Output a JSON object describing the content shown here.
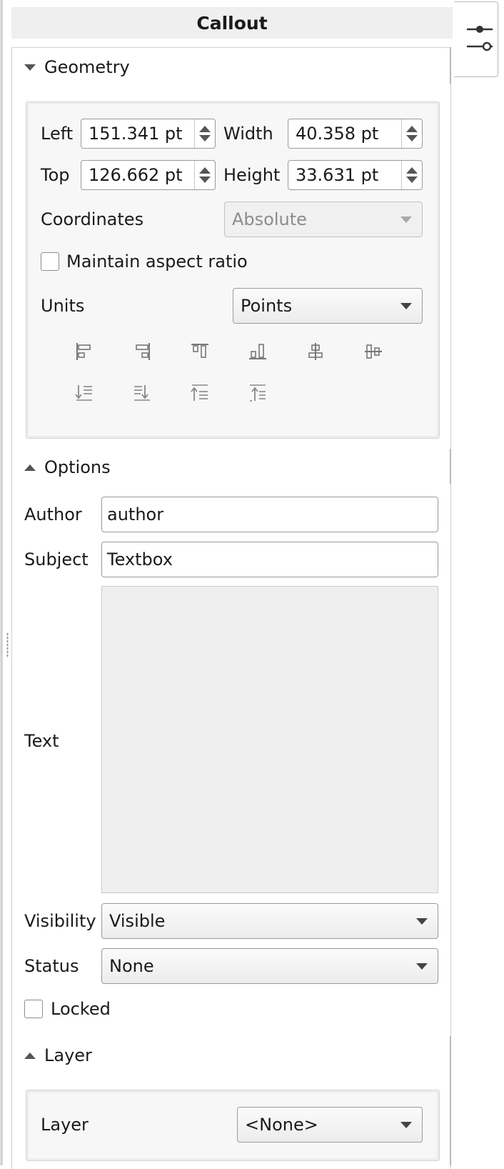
{
  "header": {
    "title": "Callout"
  },
  "geometry": {
    "section_label": "Geometry",
    "left_label": "Left",
    "left_value": "151.341 pt",
    "width_label": "Width",
    "width_value": "40.358 pt",
    "top_label": "Top",
    "top_value": "126.662 pt",
    "height_label": "Height",
    "height_value": "33.631 pt",
    "coordinates_label": "Coordinates",
    "coordinates_value": "Absolute",
    "aspect_label": "Maintain aspect ratio",
    "units_label": "Units",
    "units_value": "Points",
    "align_icons": [
      "align-left-icon",
      "align-right-icon",
      "align-top-icon",
      "align-bottom-icon",
      "align-center-horizontal-icon",
      "align-center-vertical-icon",
      "bring-to-front-icon",
      "bring-forward-icon",
      "send-backward-icon",
      "send-to-back-icon"
    ]
  },
  "options": {
    "section_label": "Options",
    "author_label": "Author",
    "author_value": "author",
    "subject_label": "Subject",
    "subject_value": "Textbox",
    "text_label": "Text",
    "text_value": "",
    "visibility_label": "Visibility",
    "visibility_value": "Visible",
    "status_label": "Status",
    "status_value": "None",
    "locked_label": "Locked"
  },
  "layer": {
    "section_label": "Layer",
    "layer_label": "Layer",
    "layer_value": "<None>"
  },
  "colors": {
    "panel_border": "#cfcfcf",
    "group_bg": "#f7f7f7",
    "title_bg": "#efefef"
  }
}
